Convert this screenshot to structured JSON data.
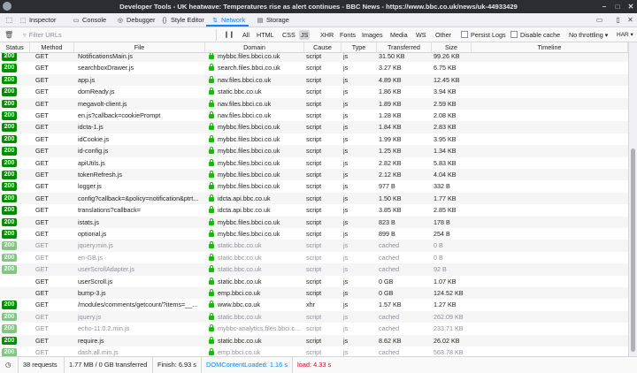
{
  "window": {
    "title": "Developer Tools - UK heatwave: Temperatures rise as alert continues - BBC News - https://www.bbc.co.uk/news/uk-44933429"
  },
  "tabs": [
    {
      "label": "Inspector",
      "icon": "inspector-icon",
      "glyph": "⬚"
    },
    {
      "label": "Console",
      "icon": "console-icon",
      "glyph": "▭"
    },
    {
      "label": "Debugger",
      "icon": "debugger-icon",
      "glyph": "◎"
    },
    {
      "label": "Style Editor",
      "icon": "braces-icon",
      "glyph": "{}"
    },
    {
      "label": "Network",
      "icon": "network-icon",
      "glyph": "⇅"
    },
    {
      "label": "Storage",
      "icon": "storage-icon",
      "glyph": "▤"
    }
  ],
  "toolbar": {
    "filter_placeholder": "Filter URLs",
    "filter_types": [
      "All",
      "HTML",
      "CSS",
      "JS",
      "XHR",
      "Fonts",
      "Images",
      "Media",
      "WS",
      "Other"
    ],
    "active_type": "JS",
    "persist_logs": "Persist Logs",
    "disable_cache": "Disable cache",
    "throttling": "No throttling",
    "har": "HAR"
  },
  "columns": [
    "Status",
    "Method",
    "File",
    "Domain",
    "Cause",
    "Type",
    "Transferred",
    "Size",
    "Timeline"
  ],
  "requests": [
    {
      "status": "200",
      "method": "GET",
      "file": "NotificationsMain.js",
      "domain": "mybbc.files.bbci.co.uk",
      "cause": "script",
      "type": "js",
      "transferred": "31.50 KB",
      "size": "99.26 KB",
      "cached": false
    },
    {
      "status": "200",
      "method": "GET",
      "file": "searchboxDrawer.js",
      "domain": "search.files.bbci.co.uk",
      "cause": "script",
      "type": "js",
      "transferred": "3.27 KB",
      "size": "6.75 KB",
      "cached": false
    },
    {
      "status": "200",
      "method": "GET",
      "file": "app.js",
      "domain": "nav.files.bbci.co.uk",
      "cause": "script",
      "type": "js",
      "transferred": "4.89 KB",
      "size": "12.45 KB",
      "cached": false
    },
    {
      "status": "200",
      "method": "GET",
      "file": "domReady.js",
      "domain": "static.bbc.co.uk",
      "cause": "script",
      "type": "js",
      "transferred": "1.86 KB",
      "size": "3.94 KB",
      "cached": false
    },
    {
      "status": "200",
      "method": "GET",
      "file": "megavolt-client.js",
      "domain": "nav.files.bbci.co.uk",
      "cause": "script",
      "type": "js",
      "transferred": "1.89 KB",
      "size": "2.59 KB",
      "cached": false
    },
    {
      "status": "200",
      "method": "GET",
      "file": "en.js?callback=cookiePrompt",
      "domain": "nav.files.bbci.co.uk",
      "cause": "script",
      "type": "js",
      "transferred": "1.28 KB",
      "size": "2.08 KB",
      "cached": false
    },
    {
      "status": "200",
      "method": "GET",
      "file": "idcta-1.js",
      "domain": "mybbc.files.bbci.co.uk",
      "cause": "script",
      "type": "js",
      "transferred": "1.84 KB",
      "size": "2.83 KB",
      "cached": false
    },
    {
      "status": "200",
      "method": "GET",
      "file": "idCookie.js",
      "domain": "mybbc.files.bbci.co.uk",
      "cause": "script",
      "type": "js",
      "transferred": "1.99 KB",
      "size": "3.95 KB",
      "cached": false
    },
    {
      "status": "200",
      "method": "GET",
      "file": "id-config.js",
      "domain": "mybbc.files.bbci.co.uk",
      "cause": "script",
      "type": "js",
      "transferred": "1.25 KB",
      "size": "1.34 KB",
      "cached": false
    },
    {
      "status": "200",
      "method": "GET",
      "file": "apiUtils.js",
      "domain": "mybbc.files.bbci.co.uk",
      "cause": "script",
      "type": "js",
      "transferred": "2.82 KB",
      "size": "5.83 KB",
      "cached": false
    },
    {
      "status": "200",
      "method": "GET",
      "file": "tokenRefresh.js",
      "domain": "mybbc.files.bbci.co.uk",
      "cause": "script",
      "type": "js",
      "transferred": "2.12 KB",
      "size": "4.04 KB",
      "cached": false
    },
    {
      "status": "200",
      "method": "GET",
      "file": "logger.js",
      "domain": "mybbc.files.bbci.co.uk",
      "cause": "script",
      "type": "js",
      "transferred": "977 B",
      "size": "332 B",
      "cached": false
    },
    {
      "status": "200",
      "method": "GET",
      "file": "config?callback=&policy=notification&ptrt...",
      "domain": "idcta.api.bbc.co.uk",
      "cause": "script",
      "type": "js",
      "transferred": "1.50 KB",
      "size": "1.77 KB",
      "cached": false
    },
    {
      "status": "200",
      "method": "GET",
      "file": "translations?callback=",
      "domain": "idcta.api.bbc.co.uk",
      "cause": "script",
      "type": "js",
      "transferred": "3.85 KB",
      "size": "2.85 KB",
      "cached": false
    },
    {
      "status": "200",
      "method": "GET",
      "file": "istats.js",
      "domain": "mybbc.files.bbci.co.uk",
      "cause": "script",
      "type": "js",
      "transferred": "823 B",
      "size": "178 B",
      "cached": false
    },
    {
      "status": "200",
      "method": "GET",
      "file": "optional.js",
      "domain": "mybbc.files.bbci.co.uk",
      "cause": "script",
      "type": "js",
      "transferred": "899 B",
      "size": "254 B",
      "cached": false
    },
    {
      "status": "200",
      "method": "GET",
      "file": "jquery.min.js",
      "domain": "static.bbc.co.uk",
      "cause": "script",
      "type": "js",
      "transferred": "cached",
      "size": "0 B",
      "cached": true
    },
    {
      "status": "200",
      "method": "GET",
      "file": "en-GB.js",
      "domain": "static.bbc.co.uk",
      "cause": "script",
      "type": "js",
      "transferred": "cached",
      "size": "0 B",
      "cached": true
    },
    {
      "status": "200",
      "method": "GET",
      "file": "userScrollAdapter.js",
      "domain": "static.bbc.co.uk",
      "cause": "script",
      "type": "js",
      "transferred": "cached",
      "size": "92 B",
      "cached": true
    },
    {
      "status": "",
      "method": "GET",
      "file": "userScroll.js",
      "domain": "static.bbc.co.uk",
      "cause": "script",
      "type": "js",
      "transferred": "0 GB",
      "size": "1.07 KB",
      "cached": false
    },
    {
      "status": "",
      "method": "GET",
      "file": "bump-3.js",
      "domain": "emp.bbci.co.uk",
      "cause": "script",
      "type": "js",
      "transferred": "0 GB",
      "size": "124.52 KB",
      "cached": false
    },
    {
      "status": "200",
      "method": "GET",
      "file": "/modules/comments/getcount/?items=__...",
      "domain": "www.bbc.co.uk",
      "cause": "xhr",
      "type": "js",
      "transferred": "1.57 KB",
      "size": "1.27 KB",
      "cached": false
    },
    {
      "status": "200",
      "method": "GET",
      "file": "jquery.js",
      "domain": "static.bbc.co.uk",
      "cause": "script",
      "type": "js",
      "transferred": "cached",
      "size": "262.09 KB",
      "cached": true
    },
    {
      "status": "200",
      "method": "GET",
      "file": "echo-11.0.2.min.js",
      "domain": "mybbc-analytics.files.bbci.c...",
      "cause": "script",
      "type": "js",
      "transferred": "cached",
      "size": "233.71 KB",
      "cached": true
    },
    {
      "status": "200",
      "method": "GET",
      "file": "require.js",
      "domain": "static.bbc.co.uk",
      "cause": "script",
      "type": "js",
      "transferred": "8.62 KB",
      "size": "26.02 KB",
      "cached": false
    },
    {
      "status": "200",
      "method": "GET",
      "file": "dash.all.min.js",
      "domain": "emp.bbci.co.uk",
      "cause": "script",
      "type": "js",
      "transferred": "cached",
      "size": "563.78 KB",
      "cached": true
    }
  ],
  "statusbar": {
    "requests": "38 requests",
    "transferred": "1.77 MB / 0 GB transferred",
    "finish": "Finish: 6.93 s",
    "dcl": "DOMContentLoaded: 1.16 s",
    "load": "load: 4.33 s"
  }
}
